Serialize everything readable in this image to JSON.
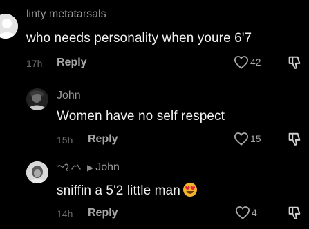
{
  "comments": [
    {
      "username": "linty metatarsals",
      "text": "who needs personality when youre 6'7",
      "time": "17h",
      "reply_label": "Reply",
      "likes": "42"
    },
    {
      "username": "John",
      "text": "Women have no self respect",
      "time": "15h",
      "reply_label": "Reply",
      "likes": "15"
    },
    {
      "reply_to": "John",
      "text": "sniffin a 5'2 little man",
      "time": "14h",
      "reply_label": "Reply",
      "likes": "4"
    }
  ],
  "colors": {
    "background": "#000000",
    "username": "#9a9a9a",
    "text": "#f2f2f2",
    "meta": "#6b6b6b"
  },
  "icons": [
    "default-avatar-icon",
    "heart-icon",
    "dislike-icon",
    "heart-eyes-emoji"
  ]
}
